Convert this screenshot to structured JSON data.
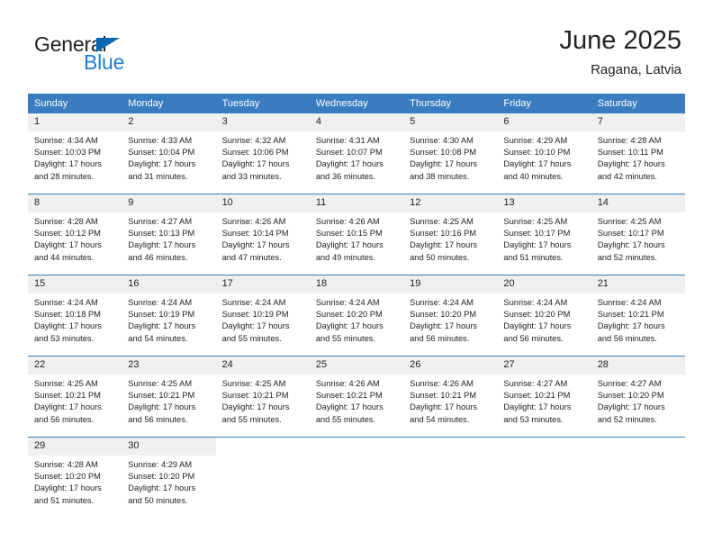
{
  "brand": {
    "name_dark": "General",
    "name_blue": "Blue",
    "color_dark": "#231f20",
    "color_blue": "#1b7fd4",
    "triangle_color": "#0a68b0"
  },
  "header": {
    "title": "June 2025",
    "subtitle": "Ragana, Latvia"
  },
  "theme": {
    "header_bg": "#3a7cc0",
    "header_text": "#ffffff",
    "daynum_bg": "#f0f0f0",
    "body_text": "#222222"
  },
  "weekdays": [
    "Sunday",
    "Monday",
    "Tuesday",
    "Wednesday",
    "Thursday",
    "Friday",
    "Saturday"
  ],
  "weeks": [
    [
      {
        "day": "1",
        "sunrise": "Sunrise: 4:34 AM",
        "sunset": "Sunset: 10:03 PM",
        "daylight_1": "Daylight: 17 hours",
        "daylight_2": "and 28 minutes."
      },
      {
        "day": "2",
        "sunrise": "Sunrise: 4:33 AM",
        "sunset": "Sunset: 10:04 PM",
        "daylight_1": "Daylight: 17 hours",
        "daylight_2": "and 31 minutes."
      },
      {
        "day": "3",
        "sunrise": "Sunrise: 4:32 AM",
        "sunset": "Sunset: 10:06 PM",
        "daylight_1": "Daylight: 17 hours",
        "daylight_2": "and 33 minutes."
      },
      {
        "day": "4",
        "sunrise": "Sunrise: 4:31 AM",
        "sunset": "Sunset: 10:07 PM",
        "daylight_1": "Daylight: 17 hours",
        "daylight_2": "and 36 minutes."
      },
      {
        "day": "5",
        "sunrise": "Sunrise: 4:30 AM",
        "sunset": "Sunset: 10:08 PM",
        "daylight_1": "Daylight: 17 hours",
        "daylight_2": "and 38 minutes."
      },
      {
        "day": "6",
        "sunrise": "Sunrise: 4:29 AM",
        "sunset": "Sunset: 10:10 PM",
        "daylight_1": "Daylight: 17 hours",
        "daylight_2": "and 40 minutes."
      },
      {
        "day": "7",
        "sunrise": "Sunrise: 4:28 AM",
        "sunset": "Sunset: 10:11 PM",
        "daylight_1": "Daylight: 17 hours",
        "daylight_2": "and 42 minutes."
      }
    ],
    [
      {
        "day": "8",
        "sunrise": "Sunrise: 4:28 AM",
        "sunset": "Sunset: 10:12 PM",
        "daylight_1": "Daylight: 17 hours",
        "daylight_2": "and 44 minutes."
      },
      {
        "day": "9",
        "sunrise": "Sunrise: 4:27 AM",
        "sunset": "Sunset: 10:13 PM",
        "daylight_1": "Daylight: 17 hours",
        "daylight_2": "and 46 minutes."
      },
      {
        "day": "10",
        "sunrise": "Sunrise: 4:26 AM",
        "sunset": "Sunset: 10:14 PM",
        "daylight_1": "Daylight: 17 hours",
        "daylight_2": "and 47 minutes."
      },
      {
        "day": "11",
        "sunrise": "Sunrise: 4:26 AM",
        "sunset": "Sunset: 10:15 PM",
        "daylight_1": "Daylight: 17 hours",
        "daylight_2": "and 49 minutes."
      },
      {
        "day": "12",
        "sunrise": "Sunrise: 4:25 AM",
        "sunset": "Sunset: 10:16 PM",
        "daylight_1": "Daylight: 17 hours",
        "daylight_2": "and 50 minutes."
      },
      {
        "day": "13",
        "sunrise": "Sunrise: 4:25 AM",
        "sunset": "Sunset: 10:17 PM",
        "daylight_1": "Daylight: 17 hours",
        "daylight_2": "and 51 minutes."
      },
      {
        "day": "14",
        "sunrise": "Sunrise: 4:25 AM",
        "sunset": "Sunset: 10:17 PM",
        "daylight_1": "Daylight: 17 hours",
        "daylight_2": "and 52 minutes."
      }
    ],
    [
      {
        "day": "15",
        "sunrise": "Sunrise: 4:24 AM",
        "sunset": "Sunset: 10:18 PM",
        "daylight_1": "Daylight: 17 hours",
        "daylight_2": "and 53 minutes."
      },
      {
        "day": "16",
        "sunrise": "Sunrise: 4:24 AM",
        "sunset": "Sunset: 10:19 PM",
        "daylight_1": "Daylight: 17 hours",
        "daylight_2": "and 54 minutes."
      },
      {
        "day": "17",
        "sunrise": "Sunrise: 4:24 AM",
        "sunset": "Sunset: 10:19 PM",
        "daylight_1": "Daylight: 17 hours",
        "daylight_2": "and 55 minutes."
      },
      {
        "day": "18",
        "sunrise": "Sunrise: 4:24 AM",
        "sunset": "Sunset: 10:20 PM",
        "daylight_1": "Daylight: 17 hours",
        "daylight_2": "and 55 minutes."
      },
      {
        "day": "19",
        "sunrise": "Sunrise: 4:24 AM",
        "sunset": "Sunset: 10:20 PM",
        "daylight_1": "Daylight: 17 hours",
        "daylight_2": "and 56 minutes."
      },
      {
        "day": "20",
        "sunrise": "Sunrise: 4:24 AM",
        "sunset": "Sunset: 10:20 PM",
        "daylight_1": "Daylight: 17 hours",
        "daylight_2": "and 56 minutes."
      },
      {
        "day": "21",
        "sunrise": "Sunrise: 4:24 AM",
        "sunset": "Sunset: 10:21 PM",
        "daylight_1": "Daylight: 17 hours",
        "daylight_2": "and 56 minutes."
      }
    ],
    [
      {
        "day": "22",
        "sunrise": "Sunrise: 4:25 AM",
        "sunset": "Sunset: 10:21 PM",
        "daylight_1": "Daylight: 17 hours",
        "daylight_2": "and 56 minutes."
      },
      {
        "day": "23",
        "sunrise": "Sunrise: 4:25 AM",
        "sunset": "Sunset: 10:21 PM",
        "daylight_1": "Daylight: 17 hours",
        "daylight_2": "and 56 minutes."
      },
      {
        "day": "24",
        "sunrise": "Sunrise: 4:25 AM",
        "sunset": "Sunset: 10:21 PM",
        "daylight_1": "Daylight: 17 hours",
        "daylight_2": "and 55 minutes."
      },
      {
        "day": "25",
        "sunrise": "Sunrise: 4:26 AM",
        "sunset": "Sunset: 10:21 PM",
        "daylight_1": "Daylight: 17 hours",
        "daylight_2": "and 55 minutes."
      },
      {
        "day": "26",
        "sunrise": "Sunrise: 4:26 AM",
        "sunset": "Sunset: 10:21 PM",
        "daylight_1": "Daylight: 17 hours",
        "daylight_2": "and 54 minutes."
      },
      {
        "day": "27",
        "sunrise": "Sunrise: 4:27 AM",
        "sunset": "Sunset: 10:21 PM",
        "daylight_1": "Daylight: 17 hours",
        "daylight_2": "and 53 minutes."
      },
      {
        "day": "28",
        "sunrise": "Sunrise: 4:27 AM",
        "sunset": "Sunset: 10:20 PM",
        "daylight_1": "Daylight: 17 hours",
        "daylight_2": "and 52 minutes."
      }
    ],
    [
      {
        "day": "29",
        "sunrise": "Sunrise: 4:28 AM",
        "sunset": "Sunset: 10:20 PM",
        "daylight_1": "Daylight: 17 hours",
        "daylight_2": "and 51 minutes."
      },
      {
        "day": "30",
        "sunrise": "Sunrise: 4:29 AM",
        "sunset": "Sunset: 10:20 PM",
        "daylight_1": "Daylight: 17 hours",
        "daylight_2": "and 50 minutes."
      },
      {
        "day": "",
        "sunrise": "",
        "sunset": "",
        "daylight_1": "",
        "daylight_2": ""
      },
      {
        "day": "",
        "sunrise": "",
        "sunset": "",
        "daylight_1": "",
        "daylight_2": ""
      },
      {
        "day": "",
        "sunrise": "",
        "sunset": "",
        "daylight_1": "",
        "daylight_2": ""
      },
      {
        "day": "",
        "sunrise": "",
        "sunset": "",
        "daylight_1": "",
        "daylight_2": ""
      },
      {
        "day": "",
        "sunrise": "",
        "sunset": "",
        "daylight_1": "",
        "daylight_2": ""
      }
    ]
  ]
}
